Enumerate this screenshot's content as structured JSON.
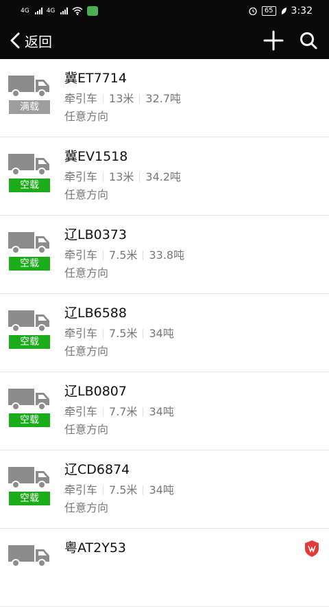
{
  "status": {
    "signal1": "4G",
    "signal2": "4G",
    "battery": "65",
    "time": "3:32"
  },
  "nav": {
    "back_label": "返回",
    "back_icon": "chevron-left-icon",
    "add_icon": "plus-icon",
    "search_icon": "search-icon"
  },
  "colors": {
    "full": "#9e9e9e",
    "empty": "#1aad19",
    "truck": "#8c8c8c"
  },
  "vehicles": [
    {
      "plate": "冀ET7714",
      "type": "牵引车",
      "length": "13米",
      "weight": "32.7吨",
      "direction": "任意方向",
      "status": "满载",
      "status_color": "#9e9e9e"
    },
    {
      "plate": "冀EV1518",
      "type": "牵引车",
      "length": "13米",
      "weight": "34.2吨",
      "direction": "任意方向",
      "status": "空载",
      "status_color": "#1aad19"
    },
    {
      "plate": "辽LB0373",
      "type": "牵引车",
      "length": "7.5米",
      "weight": "33.8吨",
      "direction": "任意方向",
      "status": "空载",
      "status_color": "#1aad19"
    },
    {
      "plate": "辽LB6588",
      "type": "牵引车",
      "length": "7.5米",
      "weight": "34吨",
      "direction": "任意方向",
      "status": "空载",
      "status_color": "#1aad19"
    },
    {
      "plate": "辽LB0807",
      "type": "牵引车",
      "length": "7.7米",
      "weight": "34吨",
      "direction": "任意方向",
      "status": "空载",
      "status_color": "#1aad19"
    },
    {
      "plate": "辽CD6874",
      "type": "牵引车",
      "length": "7.5米",
      "weight": "34吨",
      "direction": "任意方向",
      "status": "空载",
      "status_color": "#1aad19"
    },
    {
      "plate": "粤AT2Y53",
      "type": "",
      "length": "",
      "weight": "",
      "direction": "",
      "status": "",
      "status_color": "#1aad19",
      "badge_icon": "shield-icon"
    }
  ]
}
